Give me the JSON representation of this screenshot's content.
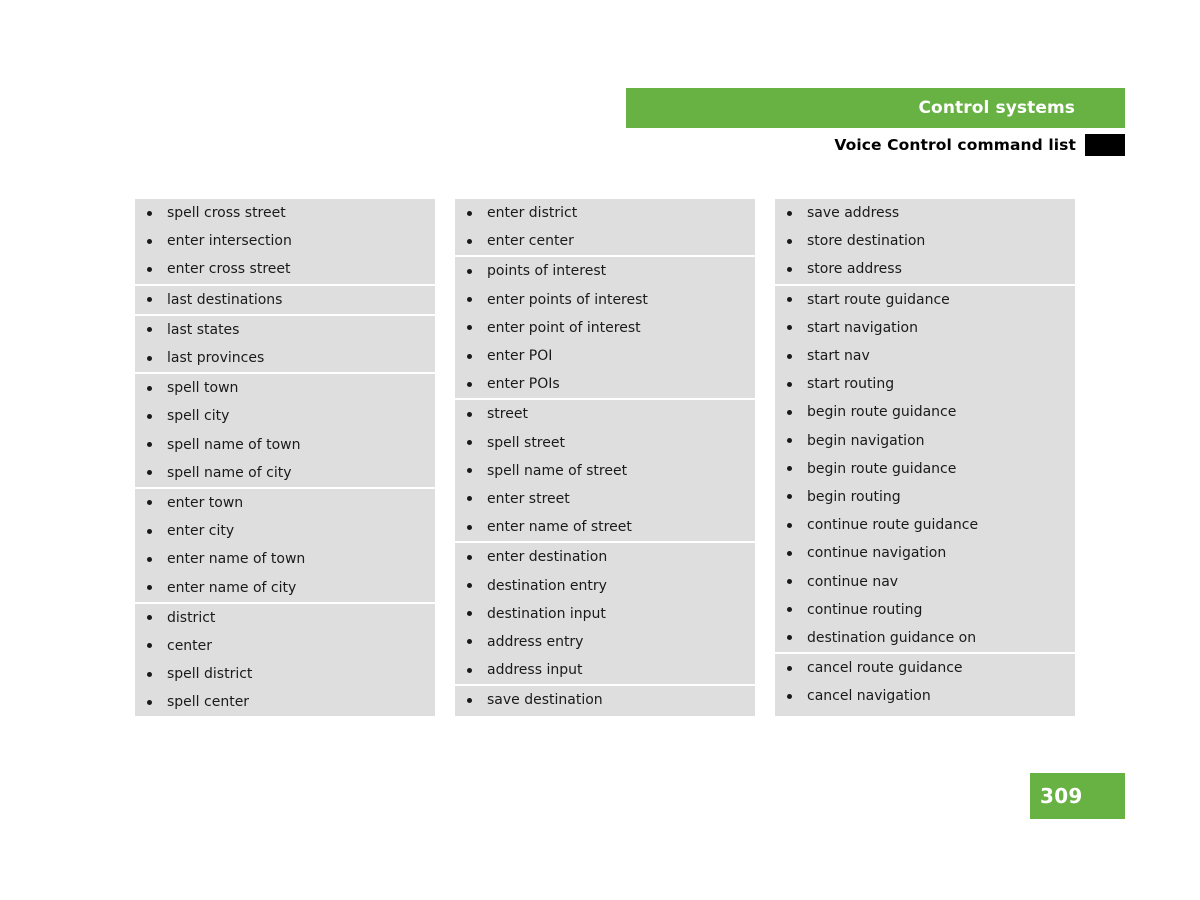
{
  "header": {
    "section_title": "Control systems",
    "subsection_title": "Voice Control command list",
    "marker_icon": "black-square-marker",
    "accent_color": "#68b244",
    "marker_color": "#000000"
  },
  "page": {
    "number": "309",
    "badge_color": "#68b244",
    "background_color": "#ffffff",
    "panel_color": "#dedede"
  },
  "columns": [
    {
      "id": "column-1",
      "groups": [
        {
          "items": [
            "spell cross street",
            "enter intersection",
            "enter cross street"
          ]
        },
        {
          "items": [
            "last destinations"
          ]
        },
        {
          "items": [
            "last states",
            "last provinces"
          ]
        },
        {
          "items": [
            "spell town",
            "spell city",
            "spell name of town",
            "spell name of city"
          ]
        },
        {
          "items": [
            "enter town",
            "enter city",
            "enter name of town",
            "enter name of city"
          ]
        },
        {
          "items": [
            "district",
            "center",
            "spell district",
            "spell center"
          ]
        }
      ]
    },
    {
      "id": "column-2",
      "groups": [
        {
          "items": [
            "enter district",
            "enter center"
          ]
        },
        {
          "items": [
            "points of interest",
            "enter points of interest",
            "enter point of interest",
            "enter POI",
            "enter POIs"
          ]
        },
        {
          "items": [
            "street",
            "spell street",
            "spell name of street",
            "enter street",
            "enter name of street"
          ]
        },
        {
          "items": [
            "enter destination",
            "destination entry",
            "destination input",
            "address entry",
            "address input"
          ]
        },
        {
          "items": [
            "save destination"
          ]
        }
      ]
    },
    {
      "id": "column-3",
      "groups": [
        {
          "items": [
            "save address",
            "store destination",
            "store address"
          ]
        },
        {
          "items": [
            "start route guidance",
            "start navigation",
            "start nav",
            "start routing",
            "begin route guidance",
            "begin navigation",
            "begin route guidance",
            "begin routing",
            "continue route guidance",
            "continue navigation",
            "continue nav",
            "continue routing",
            "destination guidance on"
          ]
        },
        {
          "items": [
            "cancel route guidance",
            "cancel navigation"
          ]
        }
      ]
    }
  ]
}
